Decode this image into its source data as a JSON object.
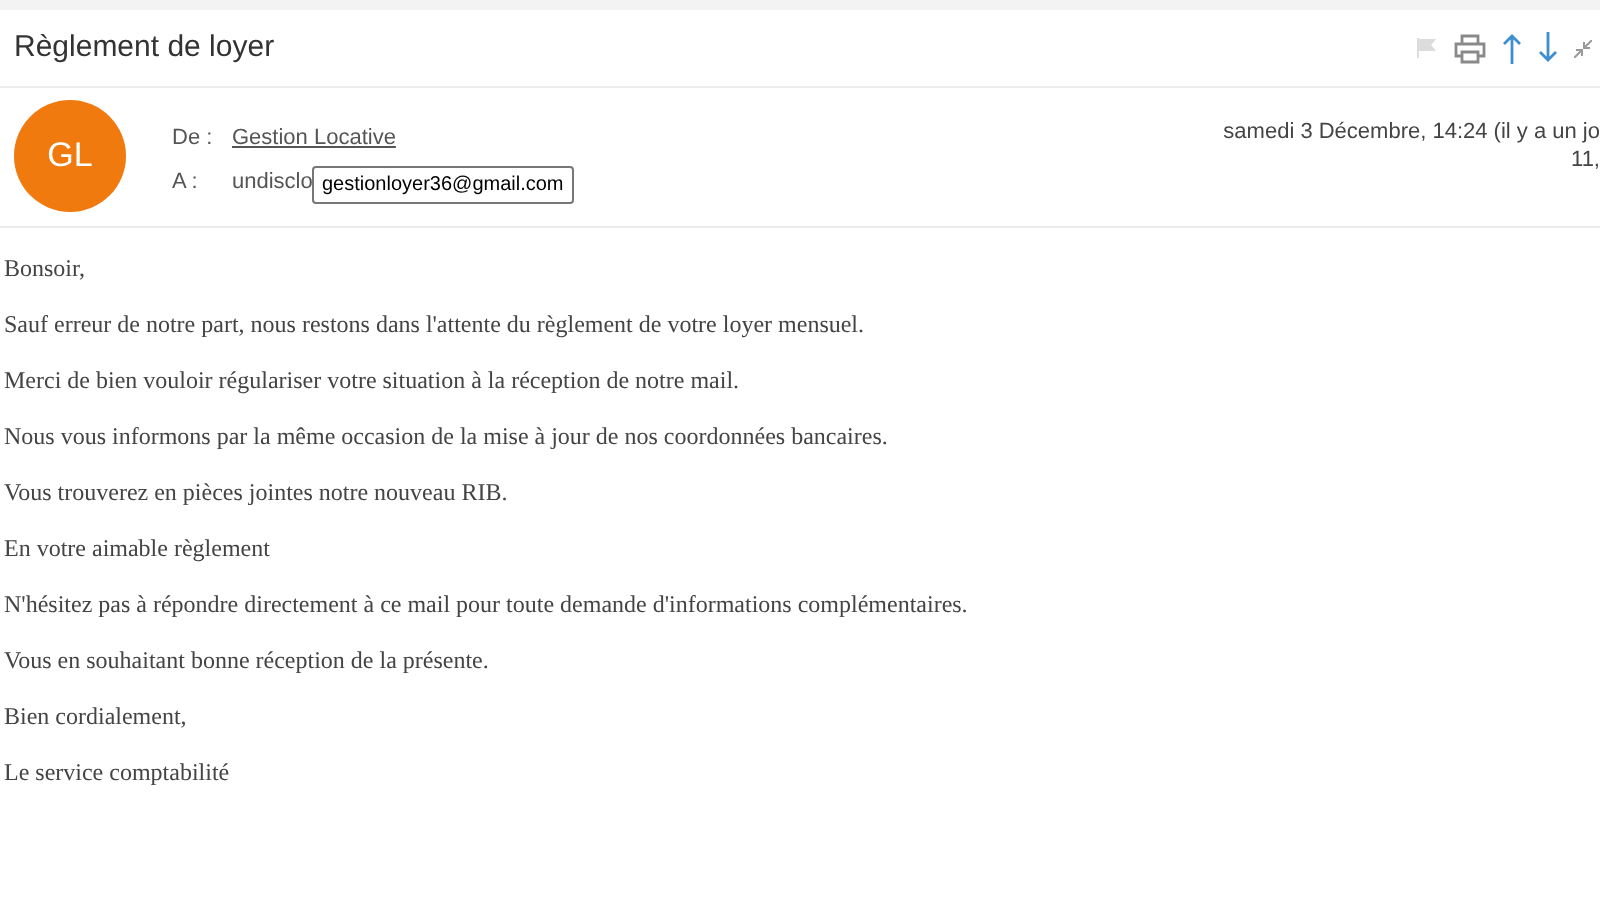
{
  "subject": "Règlement de loyer",
  "sender": {
    "initials": "GL",
    "color": "#f07a0e",
    "from_label": "De :",
    "from_name": "Gestion Locative",
    "to_label": "A :",
    "to_value": "undisclo",
    "tooltip": "gestionloyer36@gmail.com",
    "date_line_1": "samedi 3 Décembre, 14:24 (il y a un jo",
    "date_line_2": "11,"
  },
  "body": [
    "Bonsoir,",
    "Sauf erreur de notre part, nous restons dans l'attente du règlement de votre loyer mensuel.",
    "Merci de bien vouloir régulariser votre situation à la réception de notre mail.",
    "Nous vous informons par la même occasion de la mise à jour de nos coordonnées bancaires.",
    "Vous trouverez en pièces jointes notre nouveau RIB.",
    "En votre aimable règlement",
    "N'hésitez pas à répondre directement à ce mail pour toute demande d'informations complémentaires.",
    "Vous en souhaitant bonne réception de la présente.",
    "Bien cordialement,",
    "Le service comptabilité"
  ]
}
